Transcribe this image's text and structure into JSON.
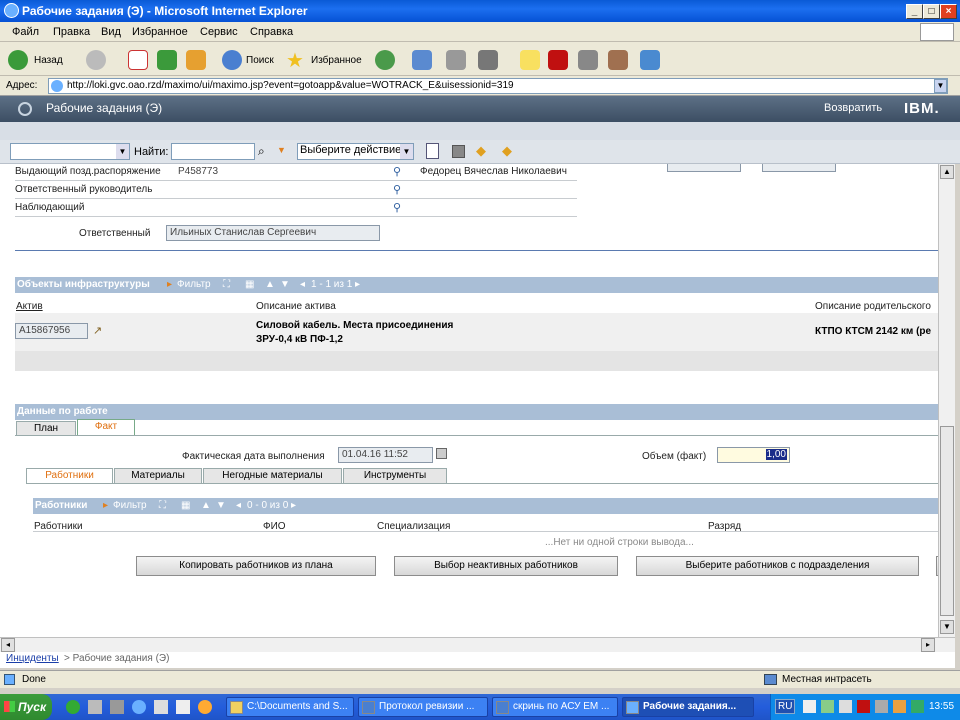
{
  "window": {
    "title": "Рабочие задания (Э) - Microsoft Internet Explorer"
  },
  "menu": [
    "Файл",
    "Правка",
    "Вид",
    "Избранное",
    "Сервис",
    "Справка"
  ],
  "toolbar": {
    "back": "Назад",
    "search": "Поиск",
    "favorites": "Избранное"
  },
  "address": {
    "label": "Адрес:",
    "url": "http://loki.gvc.oao.rzd/maximo/ui/maximo.jsp?event=gotoapp&value=WOTRACK_E&uisessionid=319"
  },
  "app": {
    "title": "Рабочие задания (Э)",
    "back": "Возвратить",
    "brand": "IBM."
  },
  "apptoolbar": {
    "find_label": "Найти:",
    "action_select": "Выберите действие"
  },
  "form": {
    "issuer_label": "Выдающий позд.распоряжение",
    "issuer_value": "P458773",
    "issuer_name": "Федорец Вячеслав Николаевич",
    "supervisor_label": "Ответственный руководитель",
    "observer_label": "Наблюдающий",
    "responsible_label": "Ответственный",
    "responsible_value": "Ильиных Станислав Сергеевич"
  },
  "infra": {
    "title": "Объекты инфраструктуры",
    "filter": "Фильтр",
    "pager": "1 - 1 из 1",
    "col_asset": "Актив",
    "col_desc": "Описание актива",
    "col_parent": "Описание родительского",
    "asset": "A15867956",
    "desc_line1": "Силовой кабель. Места присоединения",
    "desc_line2": "ЗРУ-0,4 кВ ПФ-1,2",
    "parent": "КТПО КТСМ 2142 км (ре"
  },
  "work": {
    "title": "Данные по работе",
    "tab_plan": "План",
    "tab_fact": "Факт",
    "fact_date_label": "Фактическая дата выполнения",
    "fact_date": "01.04.16 11:52",
    "volume_label": "Объем (факт)",
    "volume": "1,00",
    "subtabs": [
      "Работники",
      "Материалы",
      "Негодные материалы",
      "Инструменты"
    ]
  },
  "workers": {
    "title": "Работники",
    "filter": "Фильтр",
    "pager": "0 - 0 из 0",
    "cols": [
      "Работники",
      "ФИО",
      "Специализация",
      "Разряд"
    ],
    "empty": "...Нет ни одной строки вывода...",
    "btn_copy": "Копировать работников из плана",
    "btn_inactive": "Выбор неактивных работников",
    "btn_dept": "Выберите работников с подразделения"
  },
  "breadcrumb": {
    "link": "Инциденты",
    "current": "> Рабочие задания (Э)"
  },
  "status": {
    "text": "Done",
    "zone": "Местная интрасеть"
  },
  "taskbar": {
    "start": "Пуск",
    "tasks": [
      "C:\\Documents and S...",
      "Протокол ревизии ...",
      "скринь по АСУ ЕМ ...",
      "Рабочие задания..."
    ],
    "lang": "RU",
    "clock": "13:55"
  },
  "colors": {
    "title_blue": "#0a5ad6",
    "app_header": "#4a5d73",
    "section": "#a9bed6",
    "tab_active": "#e07010"
  }
}
